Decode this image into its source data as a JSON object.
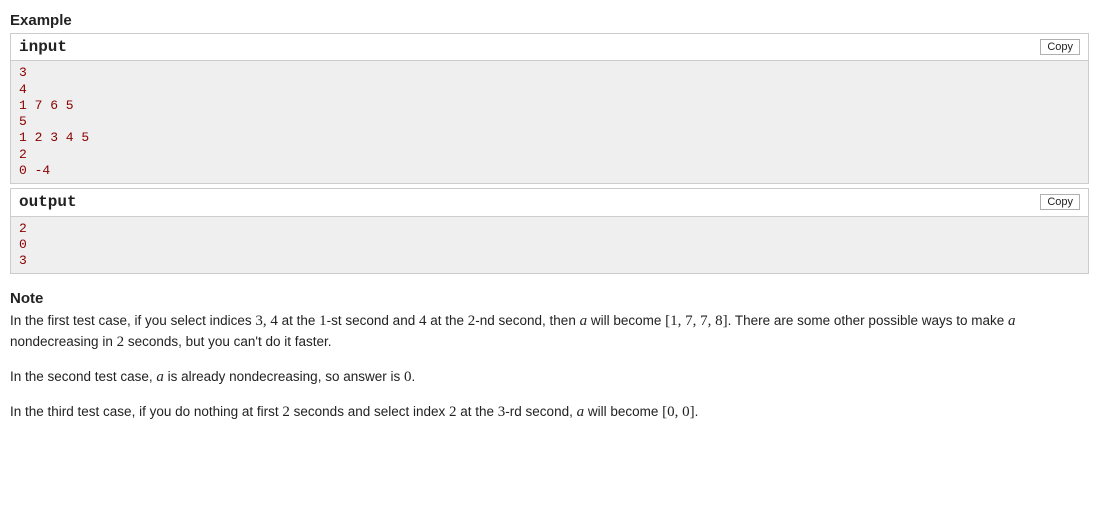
{
  "example": {
    "title": "Example",
    "input_label": "input",
    "output_label": "output",
    "copy_label": "Copy",
    "input_content": "3\n4\n1 7 6 5\n5\n1 2 3 4 5\n2\n0 -4",
    "output_content": "2\n0\n3"
  },
  "note": {
    "title": "Note",
    "p1_a": "In the first test case, if you select indices ",
    "p1_idx": "3, 4",
    "p1_b": " at the ",
    "p1_sec1": "1",
    "p1_c": "-st second and ",
    "p1_sec2_idx": "4",
    "p1_d": " at the ",
    "p1_sec2": "2",
    "p1_e": "-nd second, then ",
    "p1_var": "a",
    "p1_f": " will become ",
    "p1_arr": "[1, 7, 7, 8]",
    "p1_g": ". There are some other possible ways to make ",
    "p1_var2": "a",
    "p1_h": " nondecreasing in ",
    "p1_two": "2",
    "p1_i": " seconds, but you can't do it faster.",
    "p2_a": "In the second test case, ",
    "p2_var": "a",
    "p2_b": " is already nondecreasing, so answer is ",
    "p2_zero": "0",
    "p2_c": ".",
    "p3_a": "In the third test case, if you do nothing at first ",
    "p3_two": "2",
    "p3_b": " seconds and select index ",
    "p3_idx": "2",
    "p3_c": " at the ",
    "p3_sec": "3",
    "p3_d": "-rd second, ",
    "p3_var": "a",
    "p3_e": " will become ",
    "p3_arr": "[0, 0]",
    "p3_f": "."
  }
}
